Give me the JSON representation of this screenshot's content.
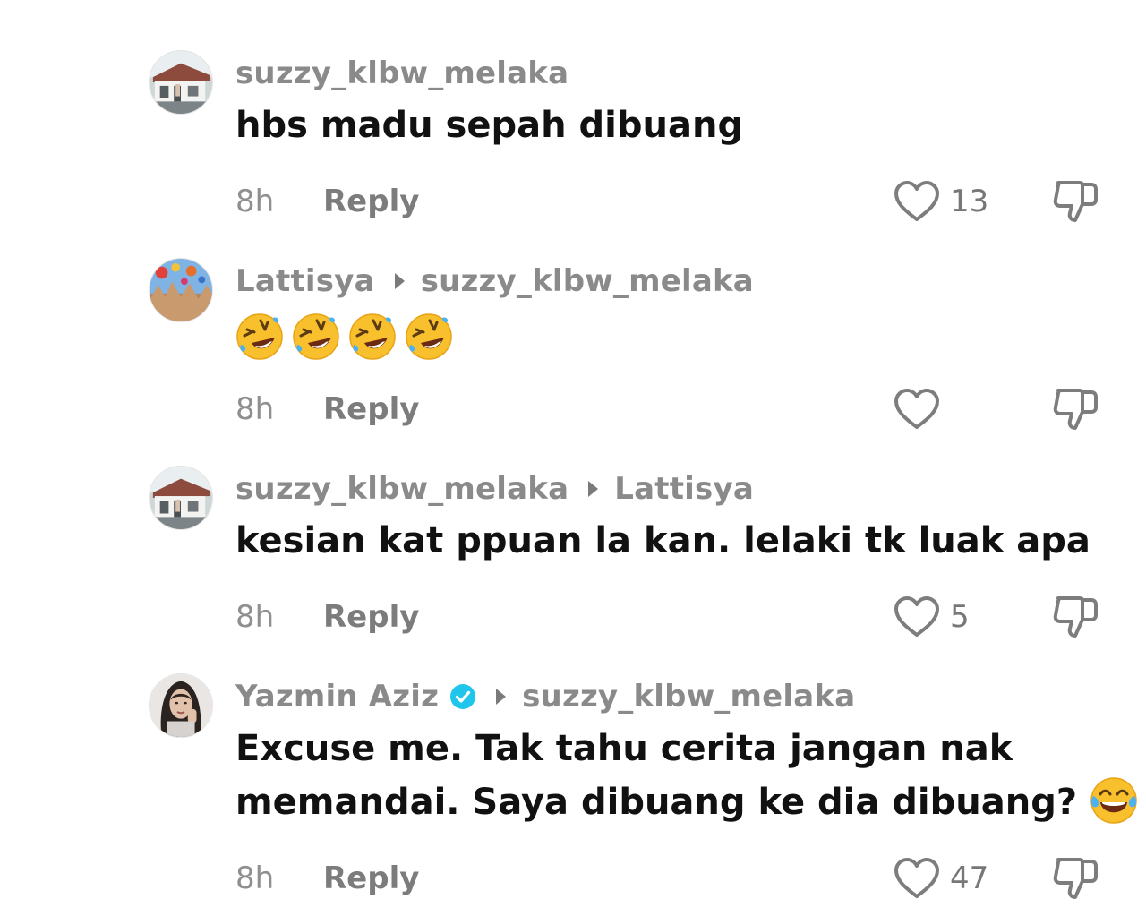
{
  "comments": [
    {
      "username": "suzzy_klbw_melaka",
      "reply_to": "",
      "verified": false,
      "text": "hbs madu sepah dibuang",
      "time": "8h",
      "reply_label": "Reply",
      "likes": "13",
      "avatar_icon": "photo-house-avatar"
    },
    {
      "username": "Lattisya",
      "reply_to": "suzzy_klbw_melaka",
      "verified": false,
      "text": "",
      "emojis": [
        "rolling-on-floor-laughing",
        "rolling-on-floor-laughing",
        "rolling-on-floor-laughing",
        "rolling-on-floor-laughing"
      ],
      "time": "8h",
      "reply_label": "Reply",
      "likes": "",
      "avatar_icon": "photo-balloons-avatar"
    },
    {
      "username": "suzzy_klbw_melaka",
      "reply_to": "Lattisya",
      "verified": false,
      "text": "kesian kat ppuan la kan. lelaki tk luak apa",
      "time": "8h",
      "reply_label": "Reply",
      "likes": "5",
      "avatar_icon": "photo-house-avatar"
    },
    {
      "username": "Yazmin Aziz",
      "reply_to": "suzzy_klbw_melaka",
      "verified": true,
      "text_line1": "Excuse me. Tak tahu cerita jangan nak",
      "text_line2": "memandai. Saya dibuang ke dia dibuang?",
      "trailing_emoji": "face-with-tears-of-joy",
      "time": "8h",
      "reply_label": "Reply",
      "likes": "47",
      "avatar_icon": "photo-woman-avatar"
    }
  ],
  "colors": {
    "username": "#8a8a8a",
    "text": "#111111",
    "meta": "#8f8f8f",
    "verified": "#20c5ec"
  }
}
